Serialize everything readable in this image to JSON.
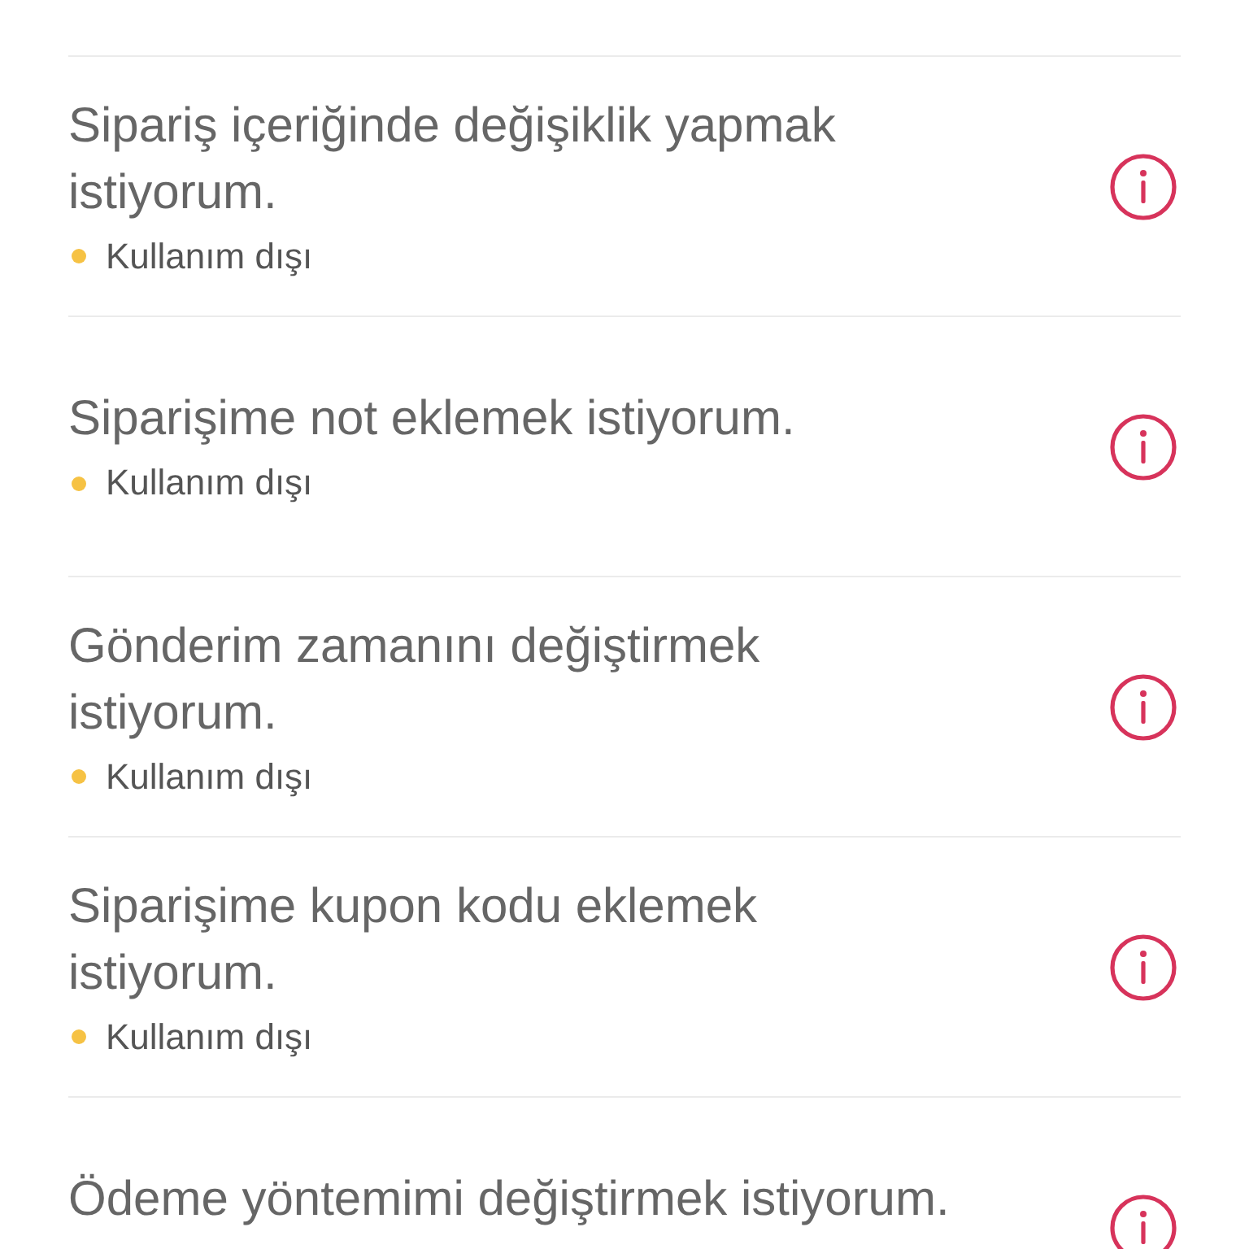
{
  "options": [
    {
      "title": "Sipariş içeriğinde değişiklik yapmak\nistiyorum.",
      "status": "Kullanım dışı",
      "color": "#f6c244"
    },
    {
      "title": "Siparişime not eklemek istiyorum.",
      "status": "Kullanım dışı",
      "color": "#f6c244"
    },
    {
      "title": "Gönderim zamanını değiştirmek\nistiyorum.",
      "status": "Kullanım dışı",
      "color": "#f6c244"
    },
    {
      "title": "Siparişime kupon kodu eklemek\nistiyorum.",
      "status": "Kullanım dışı",
      "color": "#f6c244"
    },
    {
      "title": "Ödeme yöntemimi değiştirmek istiyorum."
    }
  ]
}
